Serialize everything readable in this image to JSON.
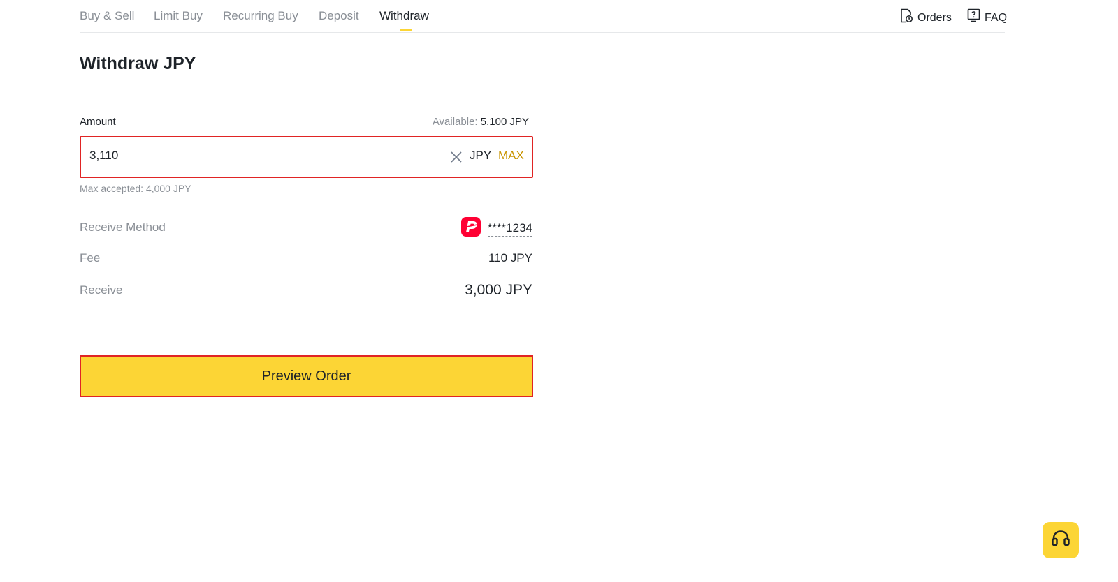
{
  "nav": {
    "tabs": [
      {
        "label": "Buy & Sell"
      },
      {
        "label": "Limit Buy"
      },
      {
        "label": "Recurring Buy"
      },
      {
        "label": "Deposit"
      },
      {
        "label": "Withdraw",
        "active": true
      }
    ],
    "orders_label": "Orders",
    "faq_label": "FAQ"
  },
  "page_title": "Withdraw JPY",
  "amount": {
    "label": "Amount",
    "available_label": "Available:",
    "available_value": "5,100 JPY",
    "value": "3,110",
    "currency": "JPY",
    "max_label": "MAX",
    "max_accepted": "Max accepted: 4,000 JPY"
  },
  "details": {
    "receive_method_label": "Receive Method",
    "receive_method_value": "****1234",
    "fee_label": "Fee",
    "fee_value": "110 JPY",
    "receive_label": "Receive",
    "receive_value": "3,000 JPY"
  },
  "preview_button_label": "Preview Order",
  "colors": {
    "accent": "#fcd535",
    "max_text": "#c99400",
    "highlight_border": "#e02424",
    "paypay_red": "#ff0033",
    "muted_text": "#8a8f96"
  },
  "icons": {
    "orders": "orders-icon",
    "faq": "faq-icon",
    "clear": "close-icon",
    "method": "paypay-icon",
    "support": "headset-icon"
  }
}
